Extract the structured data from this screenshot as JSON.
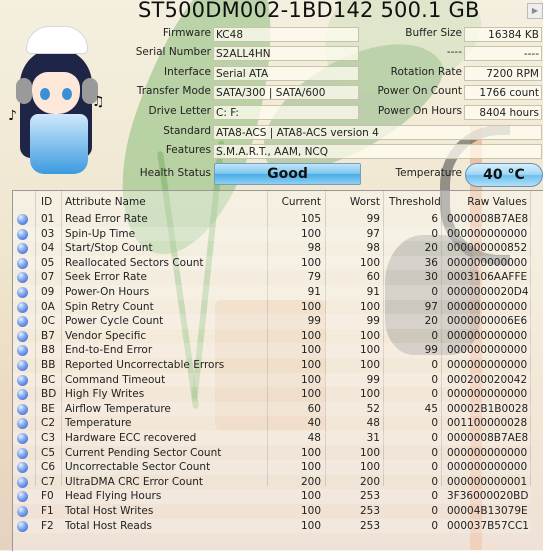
{
  "title": "ST500DM002-1BD142 500.1 GB",
  "next_button": "▶",
  "left_info": [
    {
      "label": "Firmware",
      "value": "KC48"
    },
    {
      "label": "Serial Number",
      "value": "S2ALL4HN"
    },
    {
      "label": "Interface",
      "value": "Serial ATA"
    },
    {
      "label": "Transfer Mode",
      "value": "SATA/300 | SATA/600"
    },
    {
      "label": "Drive Letter",
      "value": "C: F:"
    }
  ],
  "right_info": [
    {
      "label": "Buffer Size",
      "value": "16384 KB"
    },
    {
      "label": "----",
      "value": "----"
    },
    {
      "label": "Rotation Rate",
      "value": "7200 RPM"
    },
    {
      "label": "Power On Count",
      "value": "1766 count"
    },
    {
      "label": "Power On Hours",
      "value": "8404 hours"
    }
  ],
  "standard": {
    "label": "Standard",
    "value": "ATA8-ACS | ATA8-ACS version 4"
  },
  "features": {
    "label": "Features",
    "value": "S.M.A.R.T., AAM, NCQ"
  },
  "health": {
    "label": "Health Status",
    "value": "Good",
    "color": "#46aee6"
  },
  "temperature": {
    "label": "Temperature",
    "value": "40 °C",
    "color": "#6cc0ef"
  },
  "table": {
    "headers": {
      "id": "ID",
      "name": "Attribute Name",
      "current": "Current",
      "worst": "Worst",
      "threshold": "Threshold",
      "raw": "Raw Values"
    },
    "status_icon": "good-status-dot-icon",
    "rows": [
      {
        "id": "01",
        "name": "Read Error Rate",
        "current": "105",
        "worst": "99",
        "threshold": "6",
        "raw": "0000008B7AE8"
      },
      {
        "id": "03",
        "name": "Spin-Up Time",
        "current": "100",
        "worst": "97",
        "threshold": "0",
        "raw": "000000000000"
      },
      {
        "id": "04",
        "name": "Start/Stop Count",
        "current": "98",
        "worst": "98",
        "threshold": "20",
        "raw": "000000000852"
      },
      {
        "id": "05",
        "name": "Reallocated Sectors Count",
        "current": "100",
        "worst": "100",
        "threshold": "36",
        "raw": "000000000000"
      },
      {
        "id": "07",
        "name": "Seek Error Rate",
        "current": "79",
        "worst": "60",
        "threshold": "30",
        "raw": "0003106AAFFE"
      },
      {
        "id": "09",
        "name": "Power-On Hours",
        "current": "91",
        "worst": "91",
        "threshold": "0",
        "raw": "0000000020D4"
      },
      {
        "id": "0A",
        "name": "Spin Retry Count",
        "current": "100",
        "worst": "100",
        "threshold": "97",
        "raw": "000000000000"
      },
      {
        "id": "0C",
        "name": "Power Cycle Count",
        "current": "99",
        "worst": "99",
        "threshold": "20",
        "raw": "0000000006E6"
      },
      {
        "id": "B7",
        "name": "Vendor Specific",
        "current": "100",
        "worst": "100",
        "threshold": "0",
        "raw": "000000000000"
      },
      {
        "id": "B8",
        "name": "End-to-End Error",
        "current": "100",
        "worst": "100",
        "threshold": "99",
        "raw": "000000000000"
      },
      {
        "id": "BB",
        "name": "Reported Uncorrectable Errors",
        "current": "100",
        "worst": "100",
        "threshold": "0",
        "raw": "000000000000"
      },
      {
        "id": "BC",
        "name": "Command Timeout",
        "current": "100",
        "worst": "99",
        "threshold": "0",
        "raw": "000200020042"
      },
      {
        "id": "BD",
        "name": "High Fly Writes",
        "current": "100",
        "worst": "100",
        "threshold": "0",
        "raw": "000000000000"
      },
      {
        "id": "BE",
        "name": "Airflow Temperature",
        "current": "60",
        "worst": "52",
        "threshold": "45",
        "raw": "00002B1B0028"
      },
      {
        "id": "C2",
        "name": "Temperature",
        "current": "40",
        "worst": "48",
        "threshold": "0",
        "raw": "001100000028"
      },
      {
        "id": "C3",
        "name": "Hardware ECC recovered",
        "current": "48",
        "worst": "31",
        "threshold": "0",
        "raw": "0000008B7AE8"
      },
      {
        "id": "C5",
        "name": "Current Pending Sector Count",
        "current": "100",
        "worst": "100",
        "threshold": "0",
        "raw": "000000000000"
      },
      {
        "id": "C6",
        "name": "Uncorrectable Sector Count",
        "current": "100",
        "worst": "100",
        "threshold": "0",
        "raw": "000000000000"
      },
      {
        "id": "C7",
        "name": "UltraDMA CRC Error Count",
        "current": "200",
        "worst": "200",
        "threshold": "0",
        "raw": "000000000001"
      },
      {
        "id": "F0",
        "name": "Head Flying Hours",
        "current": "100",
        "worst": "253",
        "threshold": "0",
        "raw": "3F36000020BD"
      },
      {
        "id": "F1",
        "name": "Total Host Writes",
        "current": "100",
        "worst": "253",
        "threshold": "0",
        "raw": "00004B13079E"
      },
      {
        "id": "F2",
        "name": "Total Host Reads",
        "current": "100",
        "worst": "253",
        "threshold": "0",
        "raw": "000037B57CC1"
      }
    ]
  }
}
